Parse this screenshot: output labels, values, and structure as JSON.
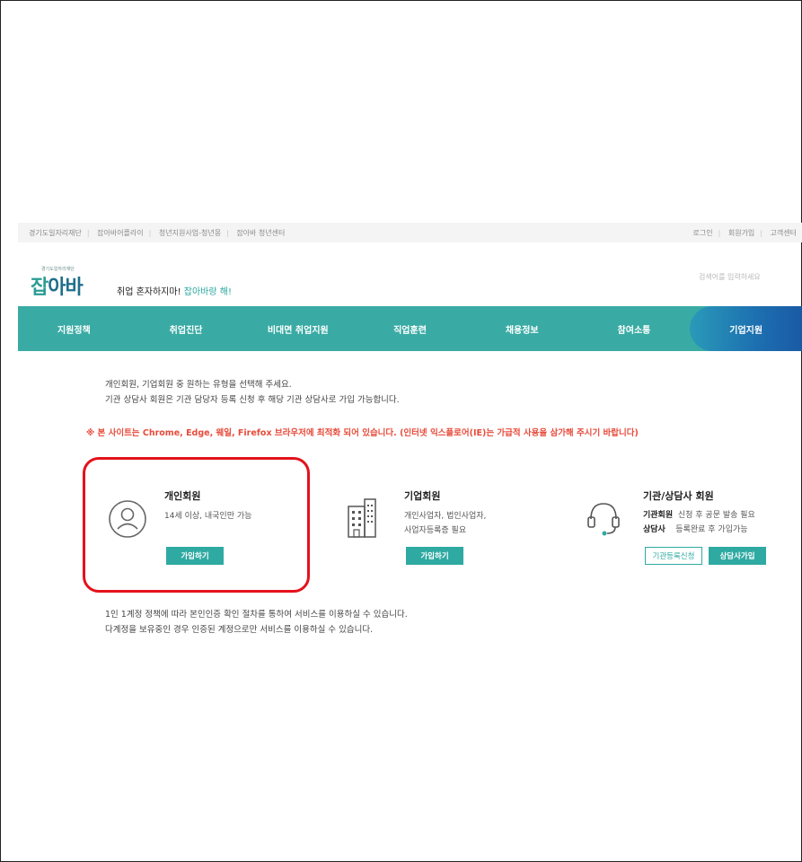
{
  "topbar": {
    "left_links": [
      "경기도일자리재단",
      "잡아바어플라이",
      "청년지원사업-청년몽",
      "잡아바 청년센터"
    ],
    "right_links": [
      "로그인",
      "회원가입",
      "고객센터"
    ]
  },
  "header": {
    "logo_small": "경기도일자리재단",
    "logo_main_a": "잡",
    "logo_main_b": "아바",
    "slogan_a": "취업 혼자하지마!",
    "slogan_b": "잡아바랑 해!",
    "search_placeholder": "검색어를 입력하세요"
  },
  "nav": {
    "items": [
      "지원정책",
      "취업진단",
      "비대면 취업지원",
      "직업훈련",
      "채용정보",
      "참여소통",
      "기업지원"
    ]
  },
  "intro": {
    "line1": "개인회원, 기업회원 중 원하는 유형을 선택해 주세요.",
    "line2": "기관 상담사 회원은 기관 담당자 등록 신청 후 해당 기관 상담사로 가입 가능합니다."
  },
  "notice": "※ 본 사이트는 Chrome, Edge, 웨일, Firefox 브라우저에 최적화 되어 있습니다. (인터넷 익스플로어(IE)는 가급적 사용을 삼가해 주시기 바랍니다)",
  "cards": {
    "personal": {
      "title": "개인회원",
      "desc": "14세 이상, 내국인만 가능",
      "button": "가입하기"
    },
    "business": {
      "title": "기업회원",
      "desc1": "개인사업자, 법인사업자,",
      "desc2": "사업자등록증 필요",
      "button": "가입하기"
    },
    "agency": {
      "title": "기관/상담사 회원",
      "row1_label": "기관회원",
      "row1_text": "신청 후 공문 발송 필요",
      "row2_label": "상담사",
      "row2_text": "등록완료 후 가입가능",
      "button_outline": "기관등록신청",
      "button_fill": "상담사가입"
    }
  },
  "footer": {
    "line1": "1인 1계정 정책에 따라 본인인증 확인 절차를 통하여 서비스를 이용하실 수 있습니다.",
    "line2": "다계정을 보유중인 경우 인증된 계정으로만 서비스를 이용하실 수 있습니다."
  },
  "colors": {
    "teal": "#3aaba4",
    "button": "#2faaa2",
    "notice": "#e84b3b",
    "highlight": "#e3121c"
  }
}
